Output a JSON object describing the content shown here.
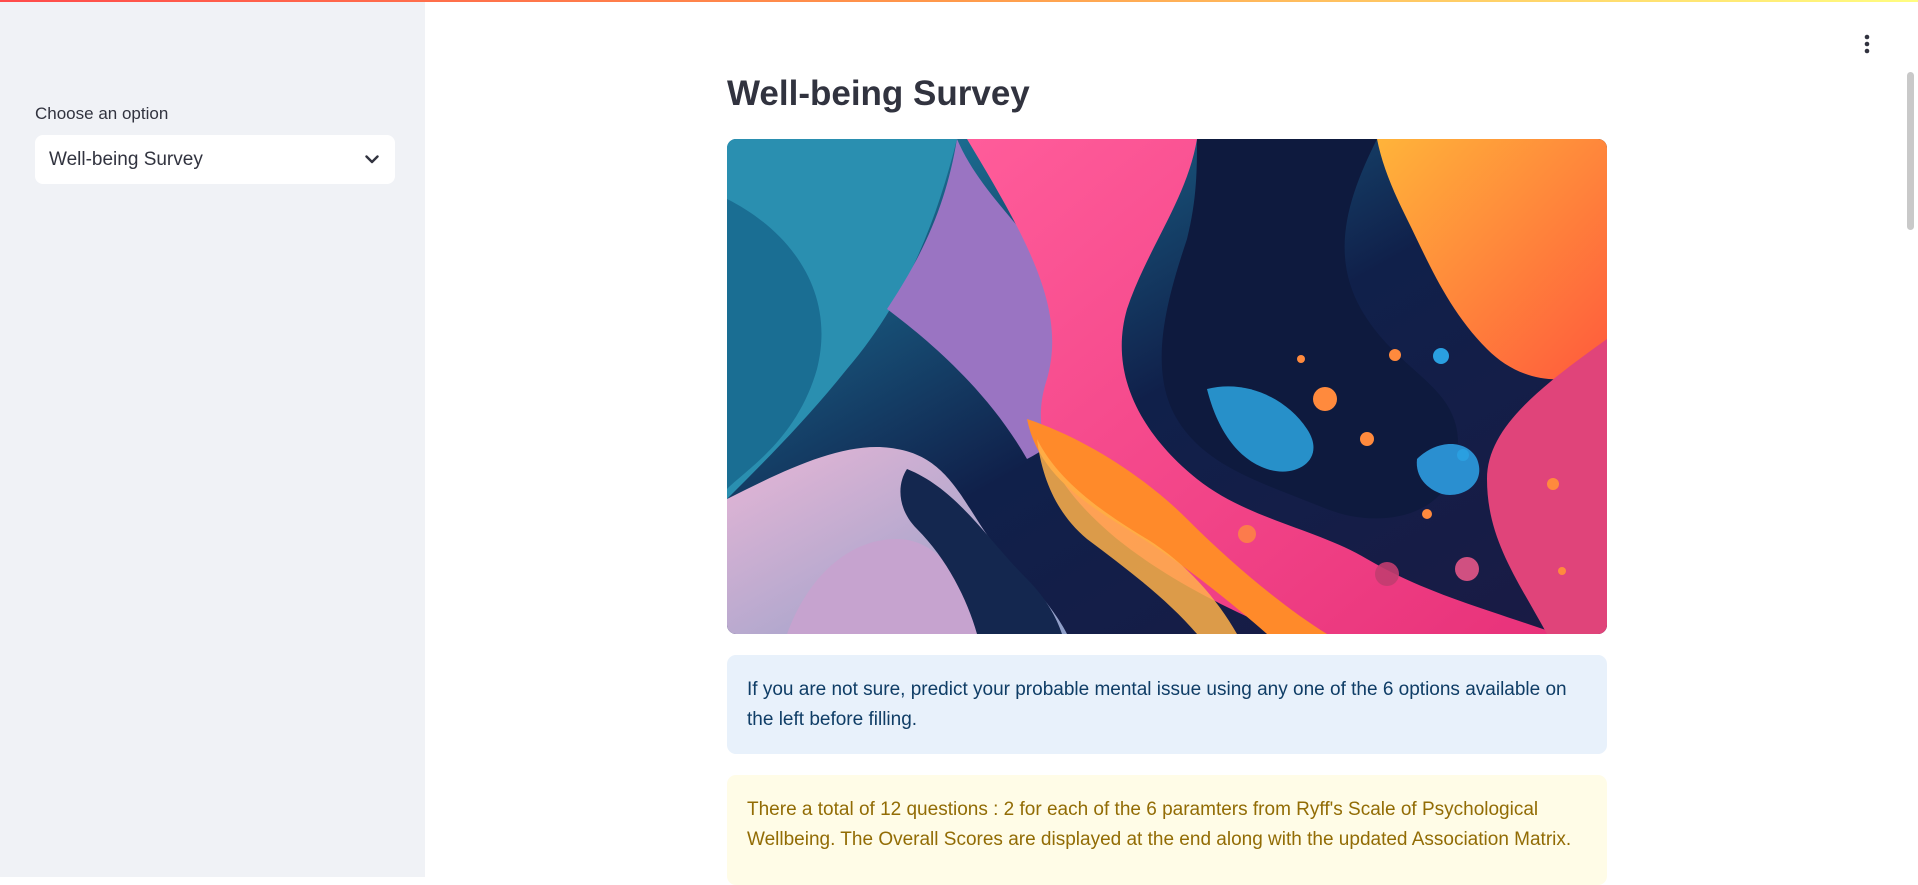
{
  "sidebar": {
    "select_label": "Choose an option",
    "selected_value": "Well-being Survey"
  },
  "main": {
    "title": "Well-being Survey",
    "info_text": "If you are not sure, predict your probable mental issue using any one of the 6 options available on the left before filling.",
    "warning_text": "There a total of 12 questions : 2 for each of the 6 paramters from Ryff's Scale of Psychological Wellbeing. The Overall Scores are displayed at the end along with the updated Association Matrix."
  },
  "icons": {
    "select_chevron": "chevron-down-icon",
    "menu": "kebab-menu-icon"
  },
  "colors": {
    "sidebar_bg": "#f0f2f6",
    "info_bg": "#e8f1fb",
    "info_text": "#0f3d66",
    "warning_bg": "#fffce7",
    "warning_text": "#926c05"
  }
}
